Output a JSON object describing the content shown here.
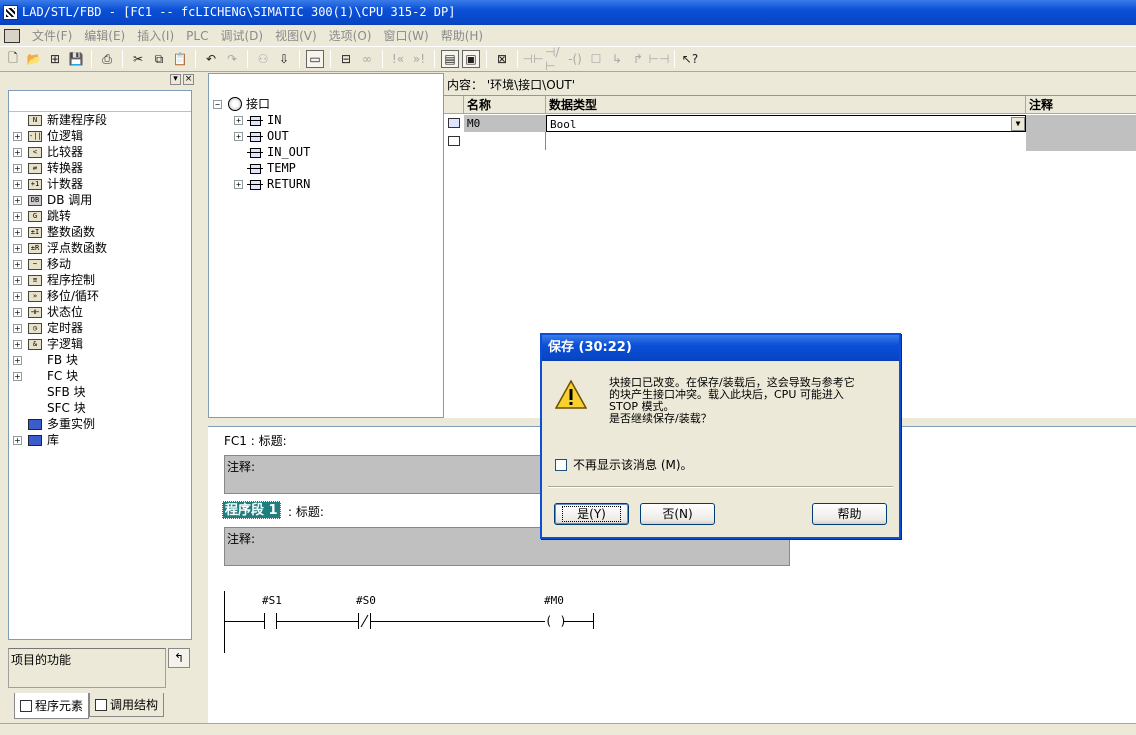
{
  "window": {
    "title": "LAD/STL/FBD  - [FC1 -- fcLICHENG\\SIMATIC 300(1)\\CPU 315-2 DP]"
  },
  "menu": {
    "items": [
      "文件(F)",
      "编辑(E)",
      "插入(I)",
      "PLC",
      "调试(D)",
      "视图(V)",
      "选项(O)",
      "窗口(W)",
      "帮助(H)"
    ]
  },
  "left_panel": {
    "tree": [
      {
        "label": "新建程序段",
        "icon": "new-network-icon",
        "expandable": false
      },
      {
        "label": "位逻辑",
        "icon": "bit-logic-icon",
        "expandable": true
      },
      {
        "label": "比较器",
        "icon": "comparator-icon",
        "expandable": true
      },
      {
        "label": "转换器",
        "icon": "converter-icon",
        "expandable": true
      },
      {
        "label": "计数器",
        "icon": "counter-icon",
        "expandable": true
      },
      {
        "label": "DB 调用",
        "icon": "db-call-icon",
        "expandable": true
      },
      {
        "label": "跳转",
        "icon": "jump-icon",
        "expandable": true
      },
      {
        "label": "整数函数",
        "icon": "integer-function-icon",
        "expandable": true
      },
      {
        "label": "浮点数函数",
        "icon": "float-function-icon",
        "expandable": true
      },
      {
        "label": "移动",
        "icon": "move-icon",
        "expandable": true
      },
      {
        "label": "程序控制",
        "icon": "program-control-icon",
        "expandable": true
      },
      {
        "label": "移位/循环",
        "icon": "shift-rotate-icon",
        "expandable": true
      },
      {
        "label": "状态位",
        "icon": "status-bit-icon",
        "expandable": true
      },
      {
        "label": "定时器",
        "icon": "timer-icon",
        "expandable": true
      },
      {
        "label": "字逻辑",
        "icon": "word-logic-icon",
        "expandable": true
      },
      {
        "label": "FB 块",
        "icon": "fb-block-icon",
        "expandable": true
      },
      {
        "label": "FC 块",
        "icon": "fc-block-icon",
        "expandable": true
      },
      {
        "label": "SFB 块",
        "icon": "sfb-block-icon",
        "expandable": false
      },
      {
        "label": "SFC 块",
        "icon": "sfc-block-icon",
        "expandable": false
      },
      {
        "label": "多重实例",
        "icon": "multi-instance-icon",
        "expandable": false
      },
      {
        "label": "库",
        "icon": "library-icon",
        "expandable": true
      }
    ],
    "function_label": "项目的功能",
    "tabs": [
      "程序元素",
      "调用结构"
    ]
  },
  "interface_tree": {
    "root": "接口",
    "items": [
      "IN",
      "OUT",
      "IN_OUT",
      "TEMP",
      "RETURN"
    ]
  },
  "content": {
    "title": "内容：  '环境\\接口\\OUT'",
    "columns": [
      "名称",
      "数据类型",
      "注释"
    ],
    "rows": [
      {
        "name": "M0",
        "type": "Bool",
        "comment": ""
      }
    ]
  },
  "code": {
    "block_header": "FC1 : 标题:",
    "block_comment": "注释:",
    "network_label": "程序段 1",
    "network_title": ": 标题:",
    "network_comment": "注释:",
    "contacts": [
      "#S1",
      "#S0",
      "#M0"
    ],
    "coil_symbol": "( )"
  },
  "dialog": {
    "title": "保存 (30:22)",
    "message": [
      "块接口已改变。在保存/装载后，这会导致与参考它",
      "的块产生接口冲突。载入此块后，CPU 可能进入",
      "STOP 模式。",
      "是否继续保存/装载？"
    ],
    "checkbox_label": "不再显示该消息 (M)。",
    "checkbox_checked": false,
    "buttons": {
      "yes": "是(Y)",
      "no": "否(N)",
      "help": "帮助"
    }
  },
  "colors": {
    "titlebar": "#0a4fd6",
    "network_label_bg": "#1f7f7f",
    "comment_bg": "#c0c0c0"
  }
}
